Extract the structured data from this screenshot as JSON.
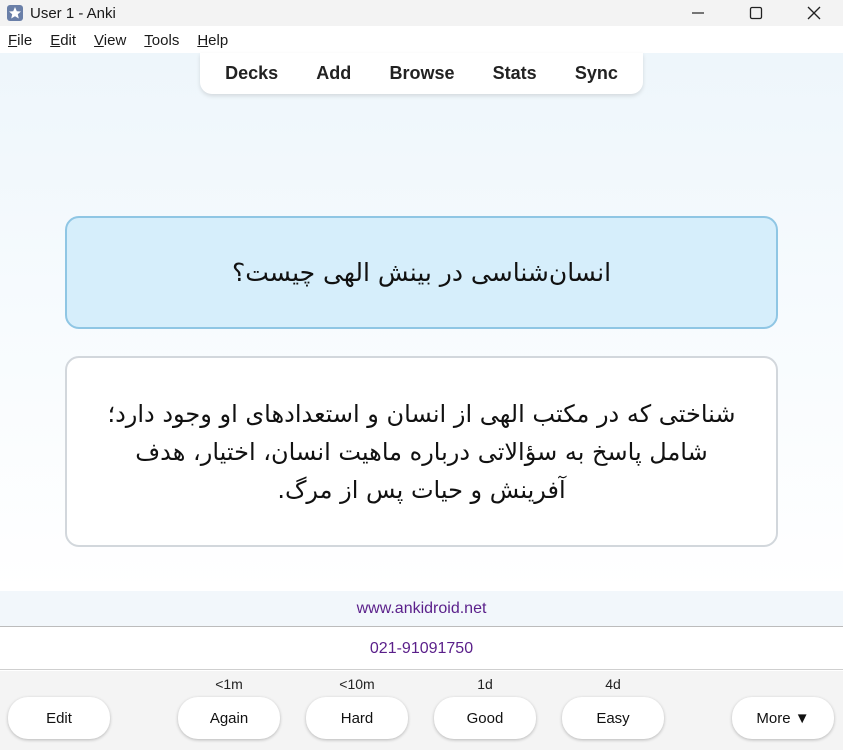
{
  "window": {
    "title": "User 1 - Anki"
  },
  "menu": [
    "File",
    "Edit",
    "View",
    "Tools",
    "Help"
  ],
  "nav": {
    "decks": "Decks",
    "add": "Add",
    "browse": "Browse",
    "stats": "Stats",
    "sync": "Sync"
  },
  "card": {
    "front": "انسان‌شناسی در بینش الهی چیست؟",
    "back": "شناختی که در مکتب الهی از انسان و استعدادهای او وجود دارد؛ شامل پاسخ به سؤالاتی درباره ماهیت انسان، اختیار، هدف آفرینش و حیات پس از مرگ."
  },
  "footer": {
    "website": "www.ankidroid.net",
    "phone": "021-91091750"
  },
  "answer": {
    "edit": "Edit",
    "more": "More ▼",
    "buttons": [
      {
        "label": "Again",
        "interval": "<1m"
      },
      {
        "label": "Hard",
        "interval": "<10m"
      },
      {
        "label": "Good",
        "interval": "1d"
      },
      {
        "label": "Easy",
        "interval": "4d"
      }
    ]
  },
  "colors": {
    "front_bg": "#d6eefb",
    "front_border": "#8fc6e4",
    "link": "#5a1f8a"
  },
  "icons": [
    "anki-app-icon",
    "minimize-icon",
    "maximize-icon",
    "close-icon"
  ]
}
